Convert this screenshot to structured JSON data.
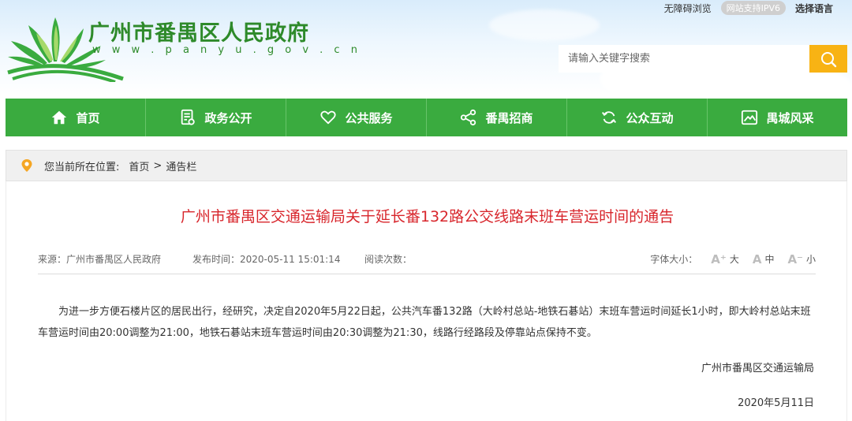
{
  "top_links": {
    "accessibility": "无障碍浏览",
    "ipv6_badge": "网站支持IPV6",
    "language": "选择语言"
  },
  "site": {
    "title": "广州市番禺区人民政府",
    "url": "w w w . p a n y u . g o v . c n"
  },
  "search": {
    "placeholder": "请输入关键字搜索",
    "icon": "search-icon"
  },
  "nav": {
    "items": [
      {
        "label": "首页",
        "icon": "home-icon"
      },
      {
        "label": "政务公开",
        "icon": "document-icon"
      },
      {
        "label": "公共服务",
        "icon": "heart-icon"
      },
      {
        "label": "番禺招商",
        "icon": "share-icon"
      },
      {
        "label": "公众互动",
        "icon": "refresh-icon"
      },
      {
        "label": "禺城风采",
        "icon": "image-icon"
      }
    ]
  },
  "breadcrumb": {
    "label": "您当前所在位置:",
    "home": "首页",
    "separator": ">",
    "current": "通告栏"
  },
  "article": {
    "title": "广州市番禺区交通运输局关于延长番132路公交线路末班车营运时间的通告",
    "source": "来源：广州市番禺区人民政府",
    "published": "发布时间：2020-05-11 15:01:14",
    "reads": "阅读次数：",
    "font_size_label": "字体大小：",
    "font_large": "大",
    "font_medium": "中",
    "font_small": "小",
    "body": "为进一步方便石楼片区的居民出行，经研究，决定自2020年5月22日起，公共汽车番132路（大岭村总站-地铁石碁站）末班车营运时间延长1小时，即大岭村总站末班车营运时间由20:00调整为21:00，地铁石碁站末班车营运时间由20:30调整为21:30，线路行经路段及停靠站点保持不变。",
    "signature": "广州市番禺区交通运输局",
    "date": "2020年5月11日"
  },
  "colors": {
    "brand_green": "#3aab3f",
    "title_red": "#d8262c",
    "search_orange": "#f8b314"
  }
}
